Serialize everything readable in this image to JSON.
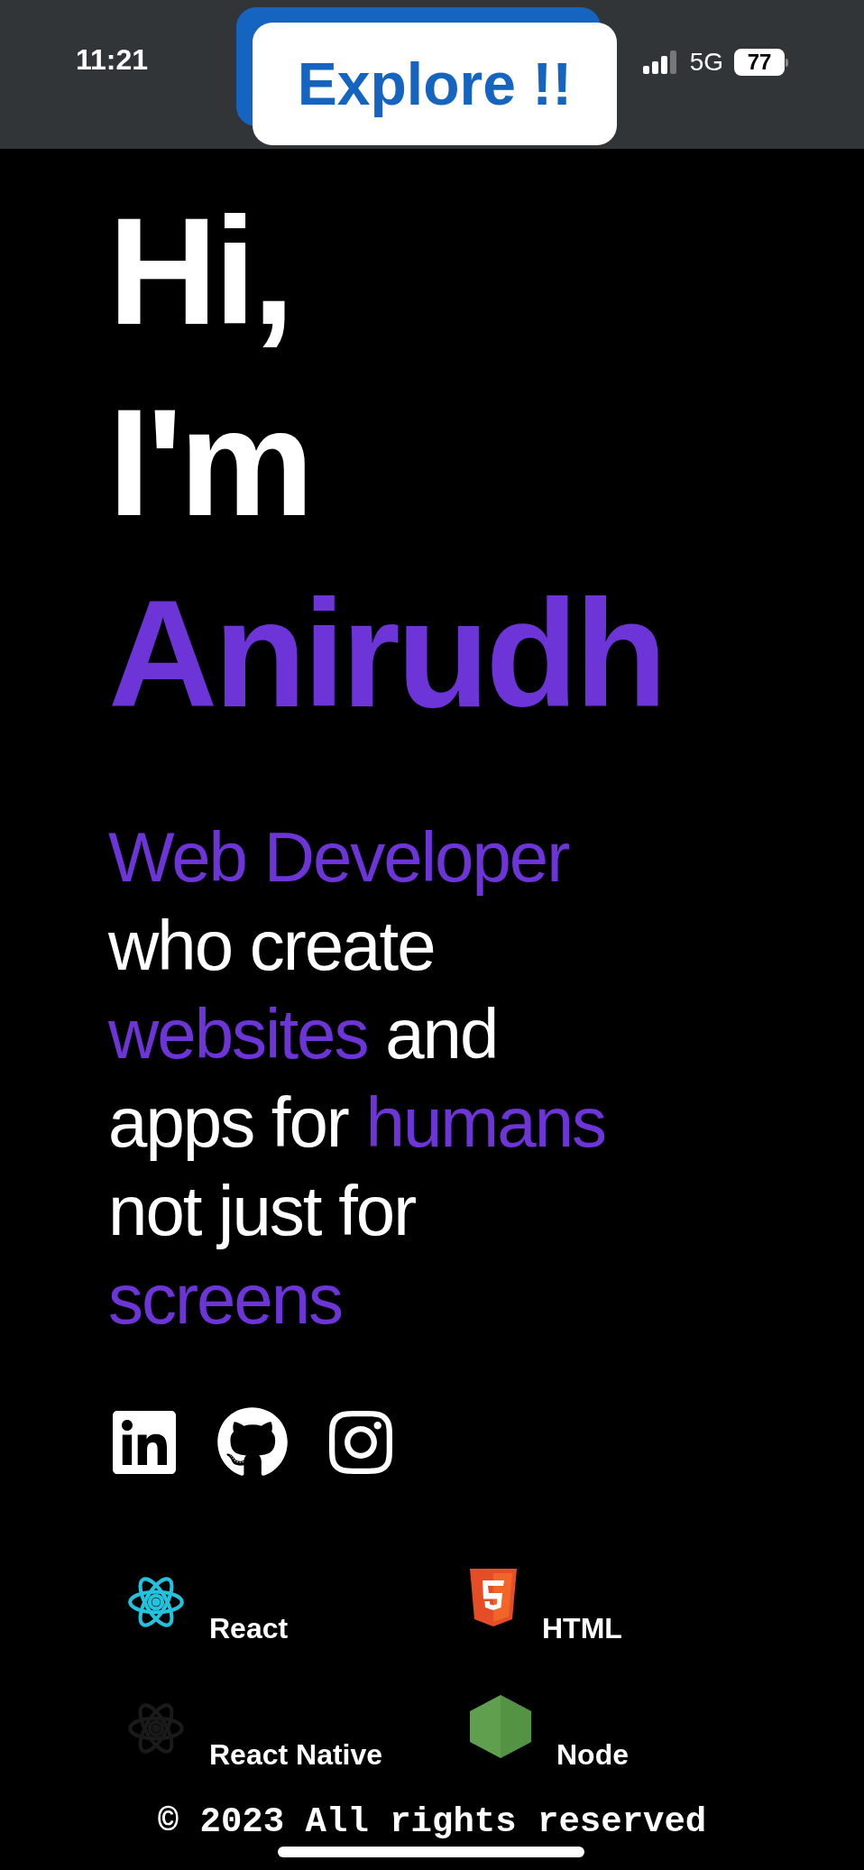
{
  "status_bar": {
    "time": "11:21",
    "network": "5G",
    "battery": "77"
  },
  "explore_button": {
    "label": "Explore !!"
  },
  "hero": {
    "lines": [
      {
        "text": "Hi,",
        "accent": false
      },
      {
        "text": "I'm",
        "accent": false
      },
      {
        "text": "Anirudh",
        "accent": true
      }
    ]
  },
  "tagline": [
    [
      {
        "text": "Web Developer",
        "accent": true
      }
    ],
    [
      {
        "text": "who create",
        "accent": false
      }
    ],
    [
      {
        "text": "websites",
        "accent": true
      },
      {
        "text": " and",
        "accent": false
      }
    ],
    [
      {
        "text": "apps for ",
        "accent": false
      },
      {
        "text": "humans",
        "accent": true
      }
    ],
    [
      {
        "text": "not just for",
        "accent": false
      }
    ],
    [
      {
        "text": "screens",
        "accent": true
      }
    ]
  ],
  "social_links": [
    {
      "kind": "linkedin"
    },
    {
      "kind": "github"
    },
    {
      "kind": "instagram"
    }
  ],
  "skills": [
    {
      "label": "React",
      "kind": "atom",
      "color": "#22c3dd"
    },
    {
      "label": "HTML",
      "kind": "html"
    },
    {
      "label": "React Native",
      "kind": "atom",
      "color": "#1a1a1a"
    },
    {
      "label": "Node",
      "kind": "hexagon"
    }
  ],
  "footer": {
    "copyright": "© 2023 All rights reserved"
  }
}
